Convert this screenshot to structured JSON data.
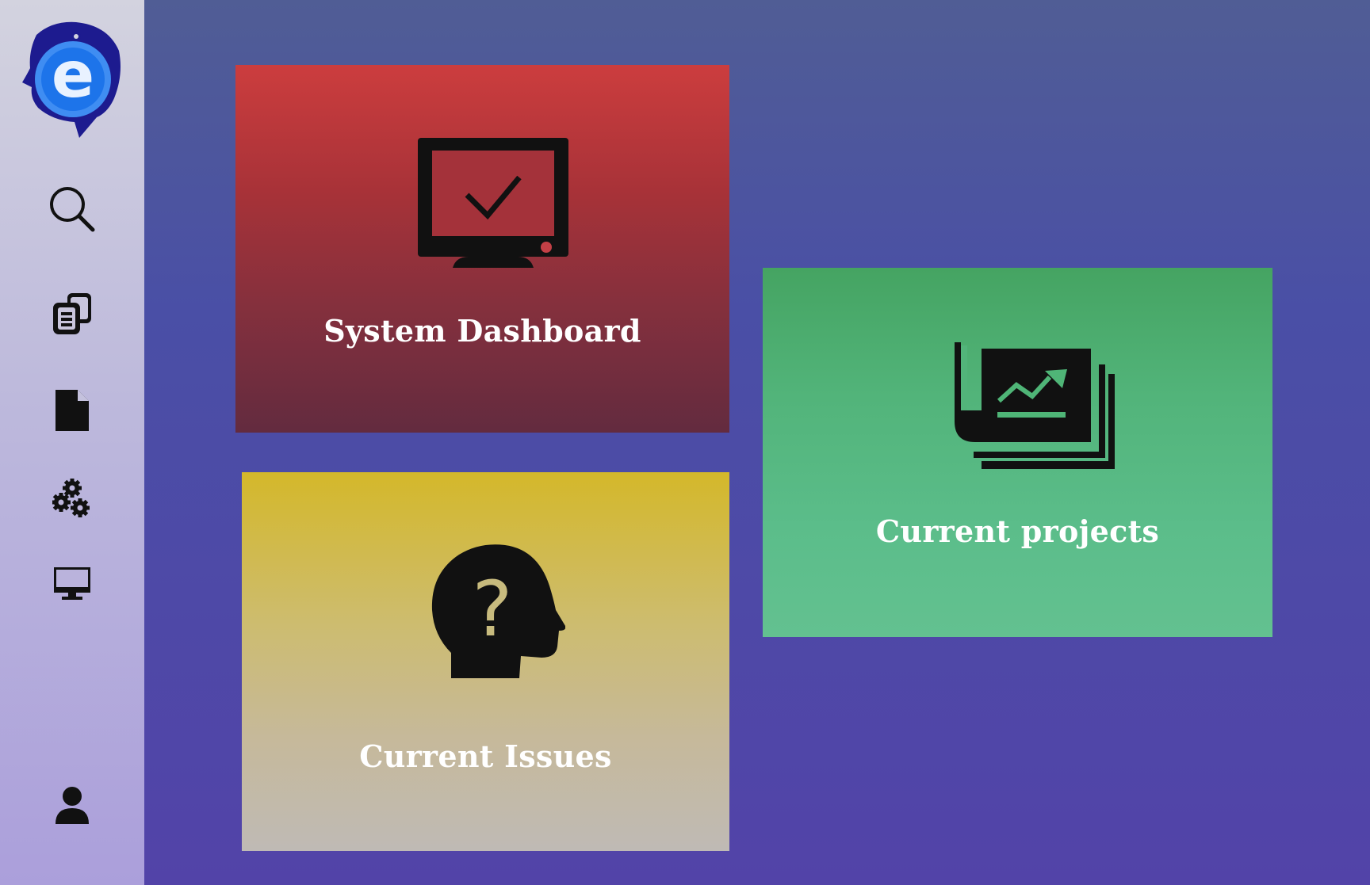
{
  "sidebar": {
    "logo": {
      "letter": "e",
      "icon": "logo-e-icon"
    },
    "items": [
      {
        "name": "search",
        "icon": "search-icon"
      },
      {
        "name": "copy-documents",
        "icon": "copy-documents-icon"
      },
      {
        "name": "document",
        "icon": "document-icon"
      },
      {
        "name": "settings",
        "icon": "gears-icon"
      },
      {
        "name": "monitor",
        "icon": "monitor-icon"
      },
      {
        "name": "user",
        "icon": "user-icon"
      }
    ]
  },
  "tiles": {
    "dashboard": {
      "label": "System Dashboard",
      "icon": "monitor-check-icon",
      "color": "#cc3d3e"
    },
    "issues": {
      "label": "Current Issues",
      "icon": "head-question-icon",
      "color": "#d4b82a"
    },
    "projects": {
      "label": "Current projects",
      "icon": "chart-stack-icon",
      "color": "#45a462"
    }
  }
}
